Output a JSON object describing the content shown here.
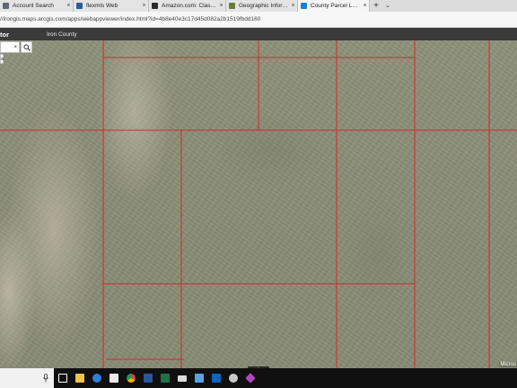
{
  "browser": {
    "tabs": [
      {
        "label": "Account Search",
        "color": "#5b6a7a"
      },
      {
        "label": "flexmls Web",
        "color": "#2f5d8a"
      },
      {
        "label": "Amazon.com: Classic Flame",
        "color": "#2b2b2b"
      },
      {
        "label": "Geographic Information Sys",
        "color": "#6b7b3a"
      },
      {
        "label": "County Parcel Locator",
        "color": "#1e7fd0",
        "active": true
      }
    ],
    "new_tab": "+",
    "tab_menu": "⌄",
    "close_glyph": "×",
    "url": "//irongis.maps.arcgis.com/apps/webappviewer/index.html?id=4b8e40e3c17d45d082a2b1519fbdd160"
  },
  "app": {
    "title": "tor",
    "subtitle": "Iron County"
  },
  "search": {
    "value": "",
    "clear": "×",
    "dropdown_text": "a"
  },
  "map": {
    "attribution": "Micros",
    "expand_label": "▲",
    "parcel_line_color": "#d42a2a"
  },
  "taskbar": {
    "icons": [
      {
        "name": "task-view-icon",
        "color": "#ffffff"
      },
      {
        "name": "file-explorer-icon",
        "color": "#f2c14e"
      },
      {
        "name": "edge-icon",
        "color": "#2f7fd8"
      },
      {
        "name": "store-icon",
        "color": "#e9e9e9"
      },
      {
        "name": "chrome-icon",
        "color": "#4caf50"
      },
      {
        "name": "word-icon",
        "color": "#2b5797"
      },
      {
        "name": "excel-icon",
        "color": "#1f7244"
      },
      {
        "name": "mail-icon",
        "color": "#dcdcdc"
      },
      {
        "name": "photos-icon",
        "color": "#5aa0e6"
      },
      {
        "name": "outlook-icon",
        "color": "#0a64c0"
      },
      {
        "name": "settings-icon",
        "color": "#c9c9c9"
      },
      {
        "name": "paint-icon",
        "color": "#b048c4"
      }
    ]
  }
}
